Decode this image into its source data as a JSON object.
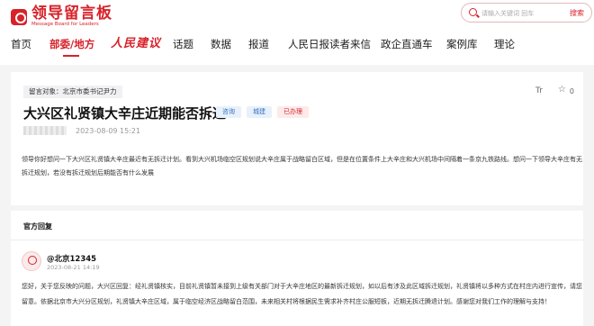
{
  "header": {
    "logo_title": "领导留言板",
    "logo_subtitle": "Message Board for Leaders",
    "search_placeholder": "请输入关键词 回车",
    "search_button": "搜索"
  },
  "nav": {
    "items": [
      "首页",
      "部委/地方",
      "人民建议",
      "话题",
      "数据",
      "报道",
      "人民日报读者来信",
      "政企直通车",
      "案例库",
      "理论"
    ]
  },
  "post": {
    "target": "留言对象：北京市委书记尹力",
    "title": "大兴区礼贤镇大辛庄近期能否拆迁",
    "badges": [
      "咨询",
      "城建",
      "已办理"
    ],
    "date": "2023-08-09 15:21",
    "like_count": "0",
    "font_tool": "Tr",
    "body": "领导你好想问一下大兴区礼贤镇大辛庄最近有无拆迁计划。看到大兴机场临空区规划说大辛庄属于战略留白区域，但是在位置条件上大辛庄和大兴机场中间隔着一条京九铁路线。想问一下领导大辛庄有无拆迁规划，若没有拆迁规划后期能否有什么发展"
  },
  "reply": {
    "heading": "官方回复",
    "org": "@北京12345",
    "date": "2023-08-21 14:19",
    "body": "您好，关于您反映的问题，大兴区回复：经礼贤镇核实，目前礼贤镇暂未接到上级有关部门对于大辛庄地区的最新拆迁规划，如以后有涉及此区域拆迁规划，礼贤镇将以多种方式在村庄内进行宣传，请您留意。依据北京市大兴分区规划，礼贤镇大辛庄区域，属于临空经济区战略留白范围，未来相关村将根据民生需求补齐村庄公服短板，近期无拆迁腾退计划。感谢您对我们工作的理解与支持！"
  },
  "colors": {
    "brand_red": "#d8222a",
    "badge_blue": "#3570c3"
  }
}
